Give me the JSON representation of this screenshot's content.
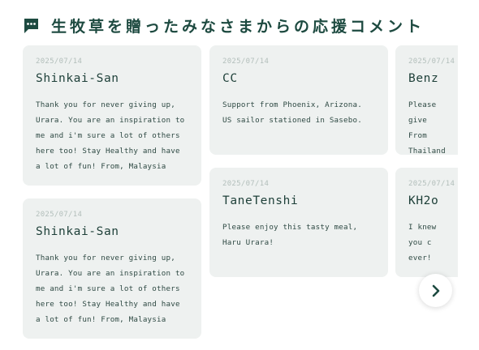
{
  "header": {
    "title": "生牧草を贈ったみなさまからの応援コメント",
    "icon": "comment-icon"
  },
  "colors": {
    "accent": "#1d4a40",
    "card_background": "#eef1f0",
    "date_text": "#b3bfbb"
  },
  "comments": [
    {
      "date": "2025/07/14",
      "name": "Shinkai-San",
      "message": "Thank you for never giving up, Urara. You are an inspiration to me and i'm sure a lot of others here too! Stay Healthy and have a lot of fun! From, Malaysia"
    },
    {
      "date": "2025/07/14",
      "name": "Shinkai-San",
      "message": "Thank you for never giving up, Urara. You are an inspiration to me and i'm sure a lot of others here too! Stay Healthy and have a lot of fun! From, Malaysia"
    },
    {
      "date": "2025/07/14",
      "name": "CC",
      "message": "Support from Phoenix, Arizona. US sailor stationed in Sasebo."
    },
    {
      "date": "2025/07/14",
      "name": "TaneTenshi",
      "message": "Please enjoy this tasty meal, Haru Urara!"
    },
    {
      "date": "2025/07/14",
      "name": "Benz",
      "message": "Please give From Thailand"
    },
    {
      "date": "2025/07/14",
      "name": "KH2o",
      "message": "I knew you c ever!"
    }
  ],
  "carousel": {
    "next_icon": "chevron-right-icon"
  }
}
